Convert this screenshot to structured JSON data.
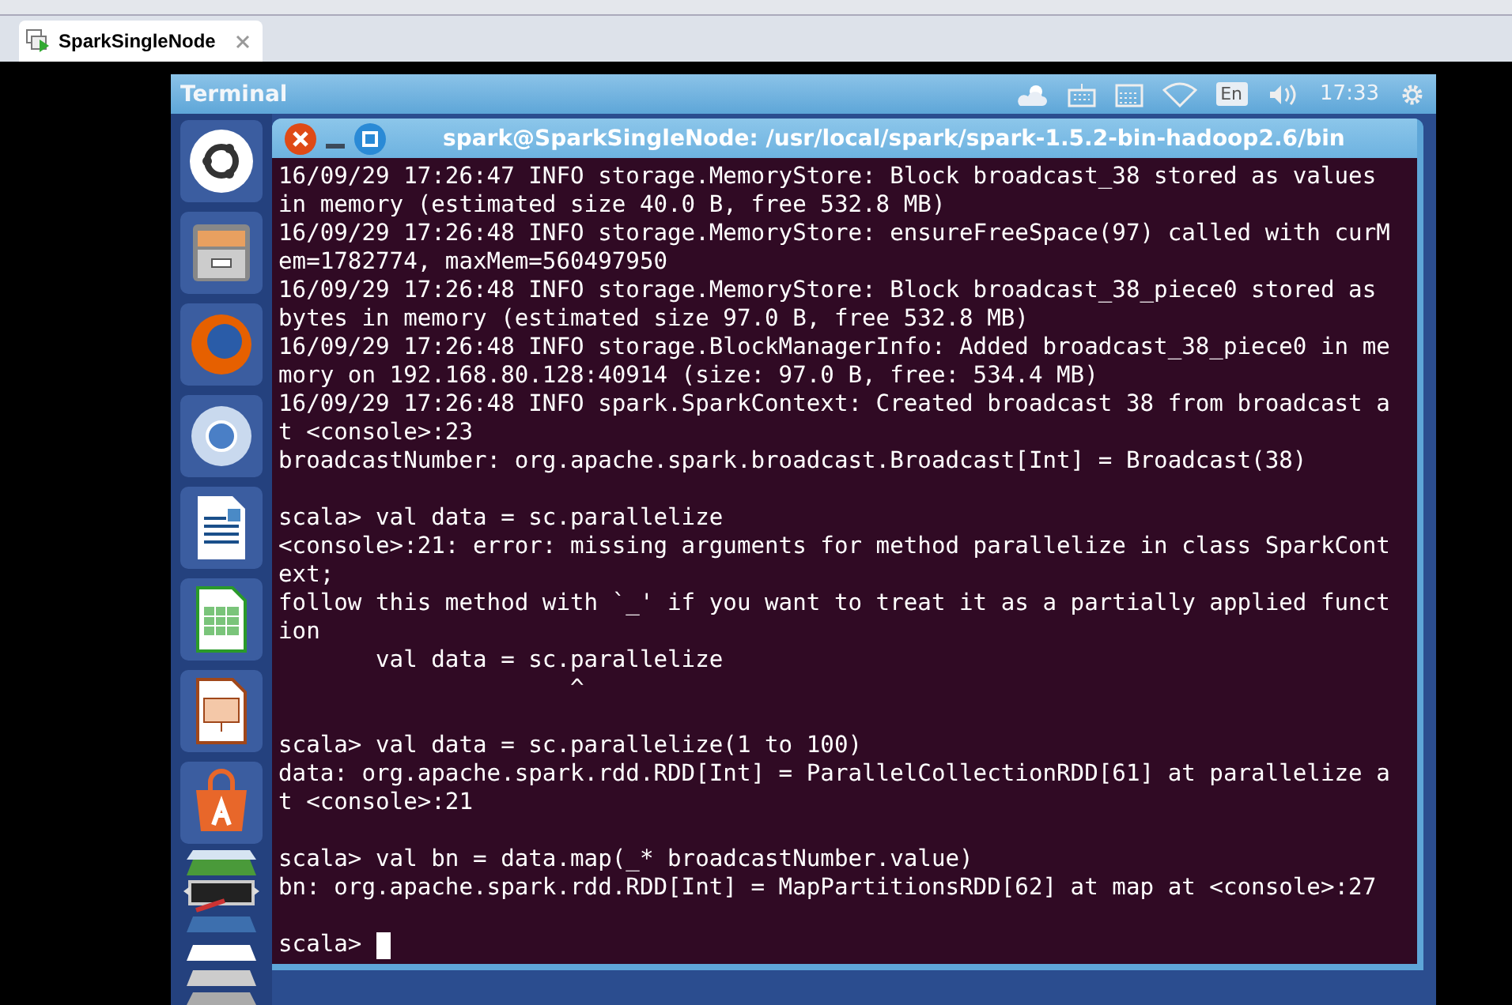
{
  "tabs": [
    {
      "label": "SparkSingleNode",
      "selected": true
    }
  ],
  "panel": {
    "title": "Terminal",
    "language": "En",
    "time": "17:33"
  },
  "window": {
    "title": "spark@SparkSingleNode: /usr/local/spark/spark-1.5.2-bin-hadoop2.6/bin"
  },
  "terminal": {
    "blocks": [
      [
        "16/09/29 17:26:47 INFO storage.MemoryStore: Block broadcast_38 stored as values",
        "in memory (estimated size 40.0 B, free 532.8 MB)",
        "16/09/29 17:26:48 INFO storage.MemoryStore: ensureFreeSpace(97) called with curM",
        "em=1782774, maxMem=560497950",
        "16/09/29 17:26:48 INFO storage.MemoryStore: Block broadcast_38_piece0 stored as",
        "bytes in memory (estimated size 97.0 B, free 532.8 MB)",
        "16/09/29 17:26:48 INFO storage.BlockManagerInfo: Added broadcast_38_piece0 in me",
        "mory on 192.168.80.128:40914 (size: 97.0 B, free: 534.4 MB)",
        "16/09/29 17:26:48 INFO spark.SparkContext: Created broadcast 38 from broadcast a",
        "t <console>:23",
        "broadcastNumber: org.apache.spark.broadcast.Broadcast[Int] = Broadcast(38)"
      ],
      [
        "scala> val data = sc.parallelize",
        "<console>:21: error: missing arguments for method parallelize in class SparkCont",
        "ext;",
        "follow this method with `_' if you want to treat it as a partially applied funct",
        "ion",
        "       val data = sc.parallelize",
        "                     ^"
      ],
      [
        "scala> val data = sc.parallelize(1 to 100)",
        "data: org.apache.spark.rdd.RDD[Int] = ParallelCollectionRDD[61] at parallelize a",
        "t <console>:21"
      ],
      [
        "scala> val bn = data.map(_* broadcastNumber.value)",
        "bn: org.apache.spark.rdd.RDD[Int] = MapPartitionsRDD[62] at map at <console>:27"
      ]
    ],
    "prompt": "scala>"
  }
}
